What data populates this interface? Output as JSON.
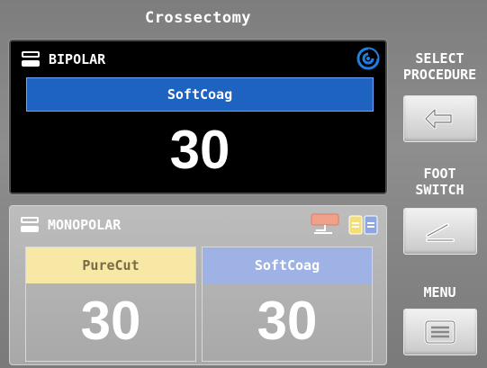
{
  "title": "Crossectomy",
  "bipolar": {
    "header": "BIPOLAR",
    "mode": "SoftCoag",
    "value": "30"
  },
  "monopolar": {
    "header": "MONOPOLAR",
    "cut": {
      "mode": "PureCut",
      "value": "30"
    },
    "coag": {
      "mode": "SoftCoag",
      "value": "30"
    }
  },
  "side": {
    "select_procedure": "SELECT\nPROCEDURE",
    "foot_switch": "FOOT\nSWITCH",
    "menu": "MENU"
  },
  "icons": {
    "bipolar_module": "bipolar-module-icon",
    "active_instrument": "swirl-icon",
    "foot_pedal": "foot-pedal-icon",
    "pedal_mode": "pedal-mode-icon",
    "select_procedure": "enter-arrow-icon",
    "foot_switch": "pedal-icon",
    "menu": "list-icon"
  },
  "colors": {
    "bipolar_mode_bar": "#1e63c0",
    "purecut_bg": "#f7e8a6",
    "softcoag_bg": "#9fb2e6",
    "swirl": "#1f7fe0"
  }
}
